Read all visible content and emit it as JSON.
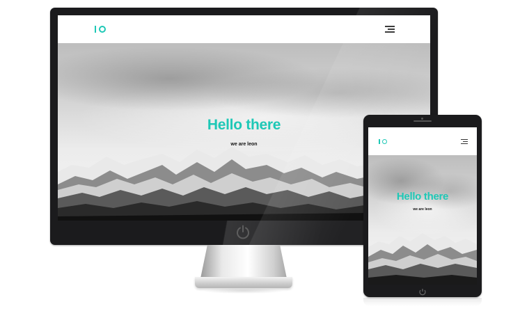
{
  "site": {
    "logo_text": "IO",
    "hero_title": "Hello there",
    "hero_subtitle": "we are leon"
  },
  "colors": {
    "accent": "#1ec8b6",
    "device_frame": "#1b1b1d",
    "header_bg": "#ffffff",
    "subtitle": "#111111"
  },
  "icons": {
    "menu": "hamburger-menu-icon",
    "power": "power-icon",
    "home": "home-button-icon"
  }
}
